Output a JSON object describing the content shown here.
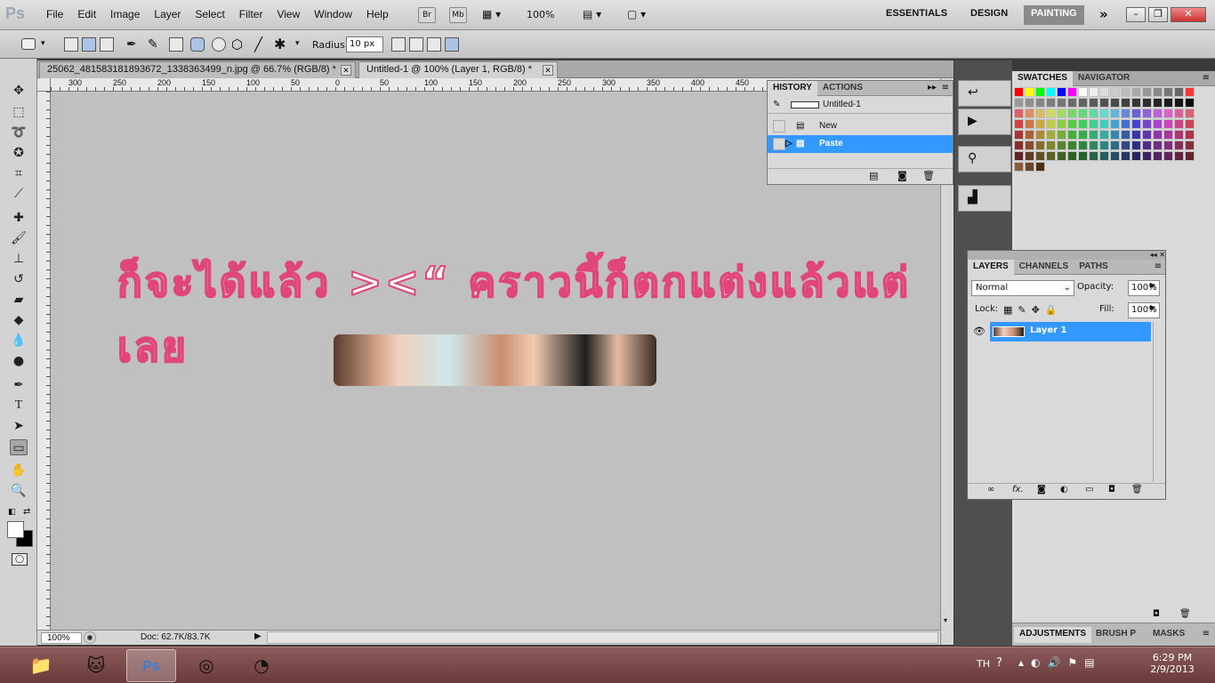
{
  "app": {
    "logo": "Ps"
  },
  "menu": [
    "File",
    "Edit",
    "Image",
    "Layer",
    "Select",
    "Filter",
    "View",
    "Window",
    "Help"
  ],
  "appbar": {
    "bridge_label": "Br",
    "minibridge_label": "Mb",
    "zoom": "100%"
  },
  "workspaces": [
    {
      "label": "ESSENTIALS",
      "active": false
    },
    {
      "label": "DESIGN",
      "active": false
    },
    {
      "label": "PAINTING",
      "active": true
    }
  ],
  "window_controls": {
    "minimize": "–",
    "restore": "❐",
    "close": "✕"
  },
  "options": {
    "radius_label": "Radius:",
    "radius_value": "10 px"
  },
  "document_tabs": [
    {
      "label": "25062_481583181893672_1338363499_n.jpg @ 66.7% (RGB/8) *",
      "active": false
    },
    {
      "label": "Untitled-1 @ 100% (Layer 1, RGB/8) *",
      "active": true
    }
  ],
  "hruler": [
    "300",
    "250",
    "200",
    "150",
    "100",
    "50",
    "0",
    "50",
    "100",
    "150",
    "200",
    "250",
    "300",
    "350",
    "400",
    "450"
  ],
  "canvas": {
    "thai_text": "ก็จะได้แล้ว ><“ คราวนี้ก็ตกแต่งแล้วแต่เลย"
  },
  "status": {
    "zoom": "100%",
    "doc": "Doc: 62.7K/83.7K"
  },
  "history": {
    "tabs": [
      "HISTORY",
      "ACTIONS"
    ],
    "snapshot": "Untitled-1",
    "states": [
      {
        "label": "New",
        "selected": false
      },
      {
        "label": "Paste",
        "selected": true
      }
    ]
  },
  "swatch_panel": {
    "tabs": [
      "SWATCHES",
      "NAVIGATOR"
    ]
  },
  "layers": {
    "tabs": [
      "LAYERS",
      "CHANNELS",
      "PATHS"
    ],
    "blend_mode": "Normal",
    "opacity_label": "Opacity:",
    "opacity": "100%",
    "lock_label": "Lock:",
    "fill_label": "Fill:",
    "fill": "100%",
    "items": [
      {
        "name": "Layer 1",
        "selected": true
      }
    ]
  },
  "adjust_panel": {
    "tabs": [
      "ADJUSTMENTS",
      "BRUSH P",
      "MASKS"
    ]
  },
  "taskbar": {
    "language": "TH",
    "time": "6:29 PM",
    "date": "2/9/2013"
  },
  "colors": {
    "accent": "#3399ff",
    "text_fill": "#ffffff",
    "text_stroke": "#e0457c"
  }
}
